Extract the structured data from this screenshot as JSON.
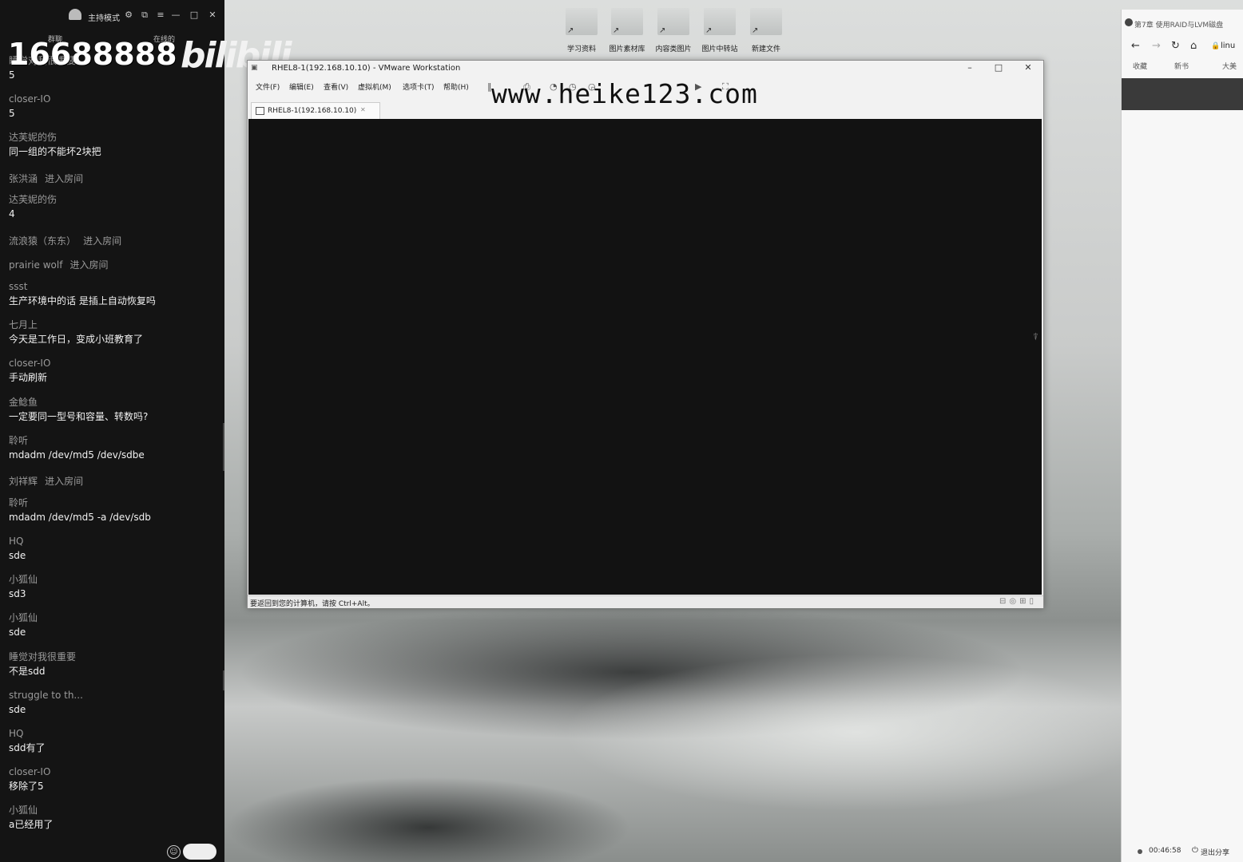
{
  "chat_panel": {
    "mode_label": "主持模式",
    "tab_left": "群聊",
    "tab_right": "在线的",
    "counter": "16688888",
    "bili_logo": "bilibili",
    "messages": [
      {
        "user": "睡觉对我很重要",
        "text": "5"
      },
      {
        "user": "closer-IO",
        "text": "5"
      },
      {
        "user": "达芙妮的伤",
        "text": "同一组的不能坏2块把"
      },
      {
        "user": "张洪涵",
        "join": "进入房间"
      },
      {
        "user": "达芙妮的伤",
        "text": "4"
      },
      {
        "user": "流浪猿（东东）",
        "join": "进入房间"
      },
      {
        "user": "prairie wolf",
        "join": "进入房间"
      },
      {
        "user": "ssst",
        "text": "生产环境中的话 是插上自动恢复吗"
      },
      {
        "user": "七月上",
        "text": "今天是工作日，变成小班教育了"
      },
      {
        "user": "closer-IO",
        "text": "手动刷新"
      },
      {
        "user": "金鲶鱼",
        "text": "一定要同一型号和容量、转数吗?"
      },
      {
        "user": "聆听",
        "text": "mdadm /dev/md5 /dev/sdbe"
      },
      {
        "user": "刘祥辉",
        "join": "进入房间"
      },
      {
        "user": "聆听",
        "text": "mdadm /dev/md5 -a /dev/sdb"
      },
      {
        "user": "HQ",
        "text": "sde"
      },
      {
        "user": "小狐仙",
        "text": "sd3"
      },
      {
        "user": "小狐仙",
        "text": "sde"
      },
      {
        "user": "睡觉对我很重要",
        "text": "不是sdd"
      },
      {
        "user": "struggle to th...",
        "text": "sde"
      },
      {
        "user": "HQ",
        "text": "sdd有了"
      },
      {
        "user": "closer-IO",
        "text": "移除了5"
      },
      {
        "user": "小狐仙",
        "text": "a已经用了"
      }
    ],
    "emoji_icon": "smile-icon"
  },
  "desktop": {
    "shortcuts": [
      "学习资料",
      "图片素材库",
      "内容类图片",
      "图片中转站",
      "新建文件"
    ]
  },
  "vmware": {
    "title": "RHEL8-1(192.168.10.10) - VMware Workstation",
    "menu": [
      "文件(F)",
      "编辑(E)",
      "查看(V)",
      "虚拟机(M)",
      "选项卡(T)",
      "帮助(H)"
    ],
    "tab_label": "RHEL8-1(192.168.10.10)",
    "status_text": "要返回到您的计算机，请按 Ctrl+Alt。",
    "watermark": "www.heike123.com",
    "console_bg": "#121212"
  },
  "browser": {
    "tab_title": "第7章 使用RAID与LVM磁盘",
    "url_fragment": "linu",
    "bookmarks": [
      "收藏",
      "新书",
      "大美"
    ],
    "session_time": "00:46:58",
    "exit_label": "退出分享"
  }
}
